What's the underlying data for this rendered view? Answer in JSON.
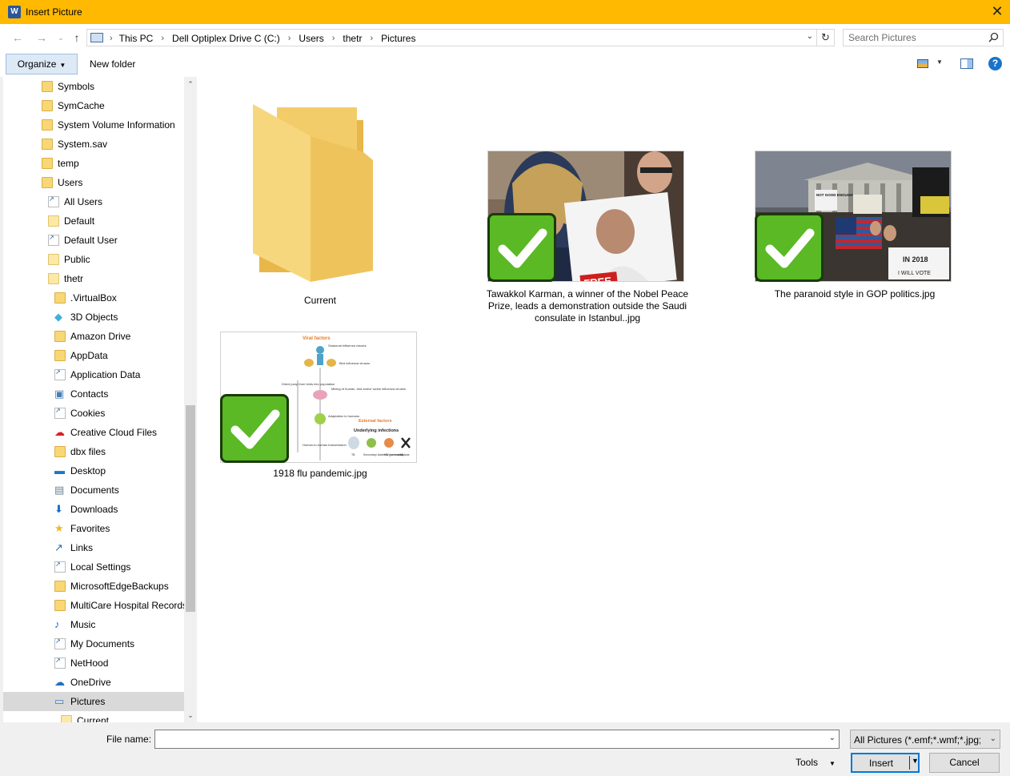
{
  "window": {
    "title": "Insert Picture",
    "app_icon_letter": "W",
    "close_glyph": "✕"
  },
  "address": {
    "crumbs": [
      "This PC",
      "Dell Optiplex Drive C (C:)",
      "Users",
      "thetr",
      "Pictures"
    ],
    "refresh_glyph": "↻"
  },
  "search": {
    "placeholder": "Search Pictures"
  },
  "toolbar": {
    "organize_label": "Organize",
    "new_folder_label": "New folder",
    "help_glyph": "?"
  },
  "nav_tree": [
    {
      "label": "Symbols",
      "icon": "folder-icon"
    },
    {
      "label": "SymCache",
      "icon": "folder-icon"
    },
    {
      "label": "System Volume Information",
      "icon": "folder-icon"
    },
    {
      "label": "System.sav",
      "icon": "folder-icon"
    },
    {
      "label": "temp",
      "icon": "folder-icon"
    },
    {
      "label": "Users",
      "icon": "folder-icon"
    },
    {
      "label": "All Users",
      "icon": "shortcut-icon"
    },
    {
      "label": "Default",
      "icon": "folder-icon"
    },
    {
      "label": "Default User",
      "icon": "shortcut-icon"
    },
    {
      "label": "Public",
      "icon": "folder-icon"
    },
    {
      "label": "thetr",
      "icon": "folder-icon"
    },
    {
      "label": ".VirtualBox",
      "icon": "folder-icon"
    },
    {
      "label": "3D Objects",
      "icon": "cube-icon"
    },
    {
      "label": "Amazon Drive",
      "icon": "folder-icon"
    },
    {
      "label": "AppData",
      "icon": "folder-icon"
    },
    {
      "label": "Application Data",
      "icon": "shortcut-icon"
    },
    {
      "label": "Contacts",
      "icon": "contacts-icon"
    },
    {
      "label": "Cookies",
      "icon": "shortcut-icon"
    },
    {
      "label": "Creative Cloud Files",
      "icon": "creative-cloud-icon"
    },
    {
      "label": "dbx files",
      "icon": "folder-icon"
    },
    {
      "label": "Desktop",
      "icon": "desktop-icon"
    },
    {
      "label": "Documents",
      "icon": "documents-icon"
    },
    {
      "label": "Downloads",
      "icon": "download-icon"
    },
    {
      "label": "Favorites",
      "icon": "star-icon"
    },
    {
      "label": "Links",
      "icon": "link-icon"
    },
    {
      "label": "Local Settings",
      "icon": "shortcut-icon"
    },
    {
      "label": "MicrosoftEdgeBackups",
      "icon": "folder-icon"
    },
    {
      "label": "MultiCare Hospital Records",
      "icon": "folder-icon"
    },
    {
      "label": "Music",
      "icon": "music-icon"
    },
    {
      "label": "My Documents",
      "icon": "shortcut-icon"
    },
    {
      "label": "NetHood",
      "icon": "shortcut-icon"
    },
    {
      "label": "OneDrive",
      "icon": "cloud-icon"
    },
    {
      "label": "Pictures",
      "icon": "pictures-icon"
    },
    {
      "label": "Current",
      "icon": "folder-icon"
    }
  ],
  "files": [
    {
      "label": "Current",
      "type": "folder"
    },
    {
      "label": "Tawakkol Karman, a winner of the Nobel Peace Prize, leads a demonstration outside the Saudi consulate in Istanbul..jpg",
      "type": "image",
      "selected": true
    },
    {
      "label": "The paranoid style in GOP politics.jpg",
      "type": "image",
      "selected": true
    },
    {
      "label": "1918 flu pandemic.jpg",
      "type": "image",
      "selected": true
    }
  ],
  "flu_thumb": {
    "viral_factors": "Viral factors",
    "seasonal": "Seasonal influenza viruses",
    "bird": "Bird influenza viruses",
    "direct_jump": "Direct jump from birds into population",
    "mixing": "Mixing of human, bird and/or swine influenza viruses",
    "adaptation": "Adaptation to humans",
    "external": "External factors",
    "underlying": "Underlying infections",
    "h2h": "Human-to-human transmission",
    "tb": "TB",
    "secondary": "Secondary bacterial pneumonia",
    "hiv": "HIV (untreated)",
    "malaria": "Malaria"
  },
  "protest_thumb": {
    "sign1": "NOT GOOD ENOUGH",
    "sign2": "IN 2018",
    "sign3": "I WILL VOTE"
  },
  "karman_thumb": {
    "sign": "FREE"
  },
  "bottom": {
    "file_name_label": "File name:",
    "file_name_value": "",
    "file_type": "All Pictures (*.emf;*.wmf;*.jpg;*",
    "tools_label": "Tools",
    "insert_label": "Insert",
    "cancel_label": "Cancel"
  },
  "colors": {
    "title_bar": "#ffb900",
    "check_green": "#5ab925",
    "accent": "#0078d7"
  }
}
